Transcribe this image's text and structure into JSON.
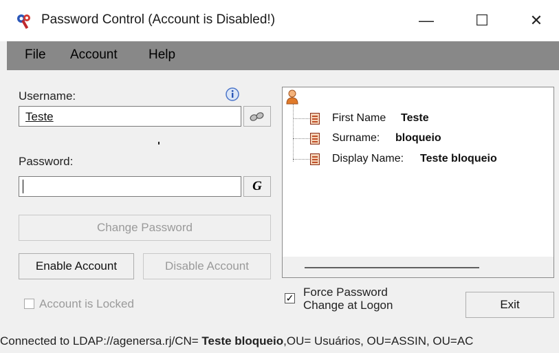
{
  "titlebar": {
    "title": "Password Control  (Account is Disabled!)",
    "app_icon": "keys-icon",
    "minimize_glyph": "—",
    "maximize_glyph": "☐",
    "close_glyph": "✕"
  },
  "menu": {
    "items": [
      "File",
      "Account",
      "Help"
    ]
  },
  "form": {
    "username_label": "Username:",
    "username_value": "Teste",
    "info_glyph": "i",
    "password_label": "Password:",
    "password_value": "",
    "generate_glyph": "G",
    "change_password_label": "Change Password",
    "enable_account_label": "Enable Account",
    "disable_account_label": "Disable Account",
    "account_locked_label": "Account is Locked",
    "account_locked_checked": false
  },
  "tree": {
    "root_icon": "user-icon",
    "rows": [
      {
        "label": "First Name",
        "value": "Teste"
      },
      {
        "label": "Surname:",
        "value": "bloqueio"
      },
      {
        "label": "Display Name:",
        "value": "Teste bloqueio"
      }
    ]
  },
  "options": {
    "force_password_line1": "Force Password",
    "force_password_line2": "Change at Logon",
    "force_password_checked": true,
    "exit_label": "Exit"
  },
  "status": {
    "prefix": "Connected to LDAP://agenersa.rj/CN= ",
    "bold": "Teste bloqueio",
    "suffix": ",OU= Usuários, OU=ASSIN, OU=AC"
  },
  "colors": {
    "menubar": "#888888",
    "user_icon": "#e07a2a"
  }
}
